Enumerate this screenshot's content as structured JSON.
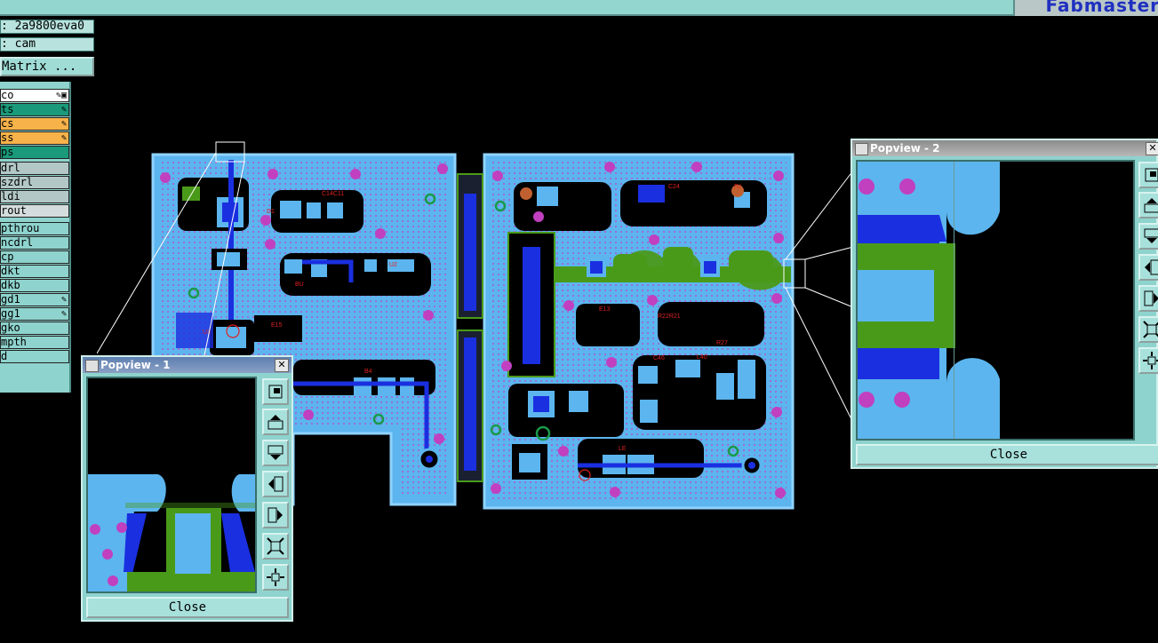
{
  "header": {
    "logo_text": "Fabmaster"
  },
  "info": {
    "job": ": 2a9800eva0",
    "step": ": cam",
    "matrix_button": "Matrix ..."
  },
  "layers": [
    {
      "label": "co",
      "color": "#ffffff",
      "mark": "✎▣"
    },
    {
      "label": "ts",
      "color": "#1a9a7a",
      "mark": "✎"
    },
    {
      "label": "cs",
      "color": "#f7b24a",
      "mark": "✎"
    },
    {
      "label": "ss",
      "color": "#f7b24a",
      "mark": "✎"
    },
    {
      "label": "ps",
      "color": "#1a9a7a",
      "mark": ""
    },
    {
      "label": "drl",
      "color": "#b3c7c7",
      "mark": ""
    },
    {
      "label": "szdrl",
      "color": "#b3c7c7",
      "mark": ""
    },
    {
      "label": "ldi",
      "color": "#b3c7c7",
      "mark": ""
    },
    {
      "label": "rout",
      "color": "#d4dcdc",
      "mark": ""
    },
    {
      "label": "pthrou",
      "color": "#8ed3cd",
      "mark": ""
    },
    {
      "label": "ncdrl",
      "color": "#8ed3cd",
      "mark": ""
    },
    {
      "label": "cp",
      "color": "#8ed3cd",
      "mark": ""
    },
    {
      "label": "dkt",
      "color": "#8ed3cd",
      "mark": ""
    },
    {
      "label": "dkb",
      "color": "#8ed3cd",
      "mark": ""
    },
    {
      "label": "gd1",
      "color": "#8ed3cd",
      "mark": "✎"
    },
    {
      "label": "gg1",
      "color": "#8ed3cd",
      "mark": "✎"
    },
    {
      "label": "gko",
      "color": "#8ed3cd",
      "mark": ""
    },
    {
      "label": "mpth",
      "color": "#8ed3cd",
      "mark": ""
    },
    {
      "label": "d",
      "color": "#8ed3cd",
      "mark": ""
    }
  ],
  "popview1": {
    "title": "Popview - 1",
    "close": "Close"
  },
  "popview2": {
    "title": "Popview - 2",
    "close": "Close"
  },
  "toolbar_icons": [
    "zoom-box-icon",
    "pan-up-icon",
    "pan-down-icon",
    "pan-left-icon",
    "pan-right-icon",
    "zoom-fit-icon",
    "zoom-center-icon"
  ],
  "colors": {
    "copper": "#4fa8e8",
    "trace": "#1a2fe0",
    "plane": "#4a9a1a",
    "pad_magenta": "#c040c0",
    "silk": "#e02020",
    "background": "#000000"
  }
}
